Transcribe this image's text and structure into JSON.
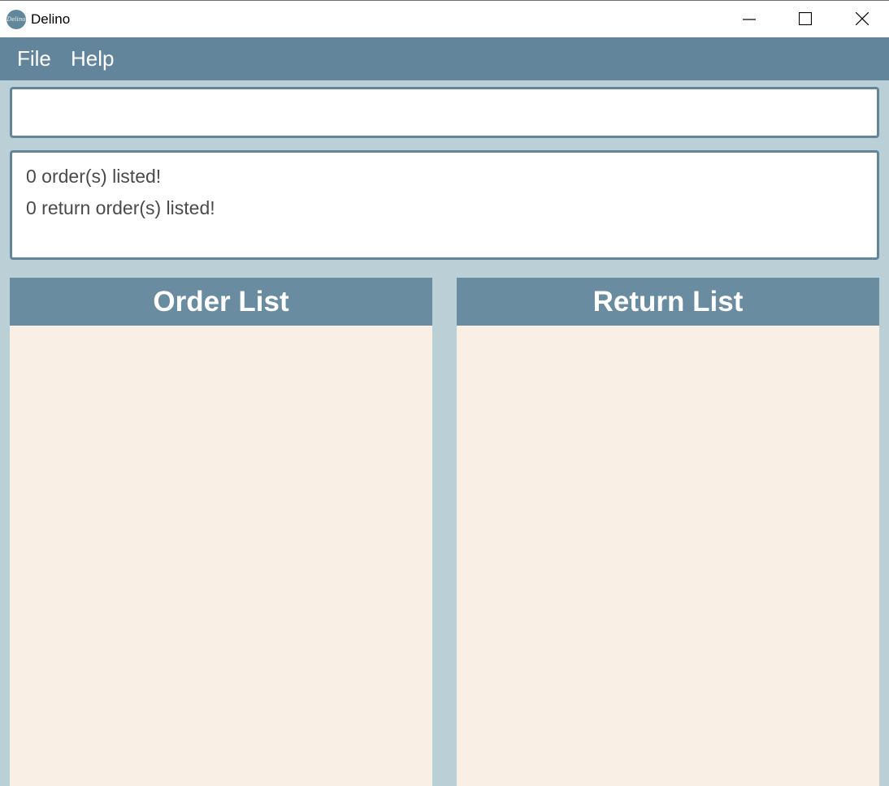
{
  "window": {
    "title": "Delino",
    "icon_text": "Delino",
    "icon": "delino-app-icon",
    "controls": {
      "minimize": "minimize-icon",
      "maximize": "maximize-icon",
      "close": "close-icon"
    }
  },
  "menubar": {
    "items": [
      {
        "label": "File"
      },
      {
        "label": "Help"
      }
    ]
  },
  "command": {
    "value": "",
    "placeholder": ""
  },
  "result": {
    "lines": [
      "0 order(s) listed!",
      "0 return order(s) listed!"
    ]
  },
  "panels": {
    "orders": {
      "title": "Order List",
      "items": []
    },
    "returns": {
      "title": "Return List",
      "items": []
    }
  },
  "colors": {
    "background": "#bacfd6",
    "menubar": "#62859b",
    "panel_header": "#6a8ca1",
    "panel_body": "#f9efe5",
    "border": "#62859b"
  }
}
